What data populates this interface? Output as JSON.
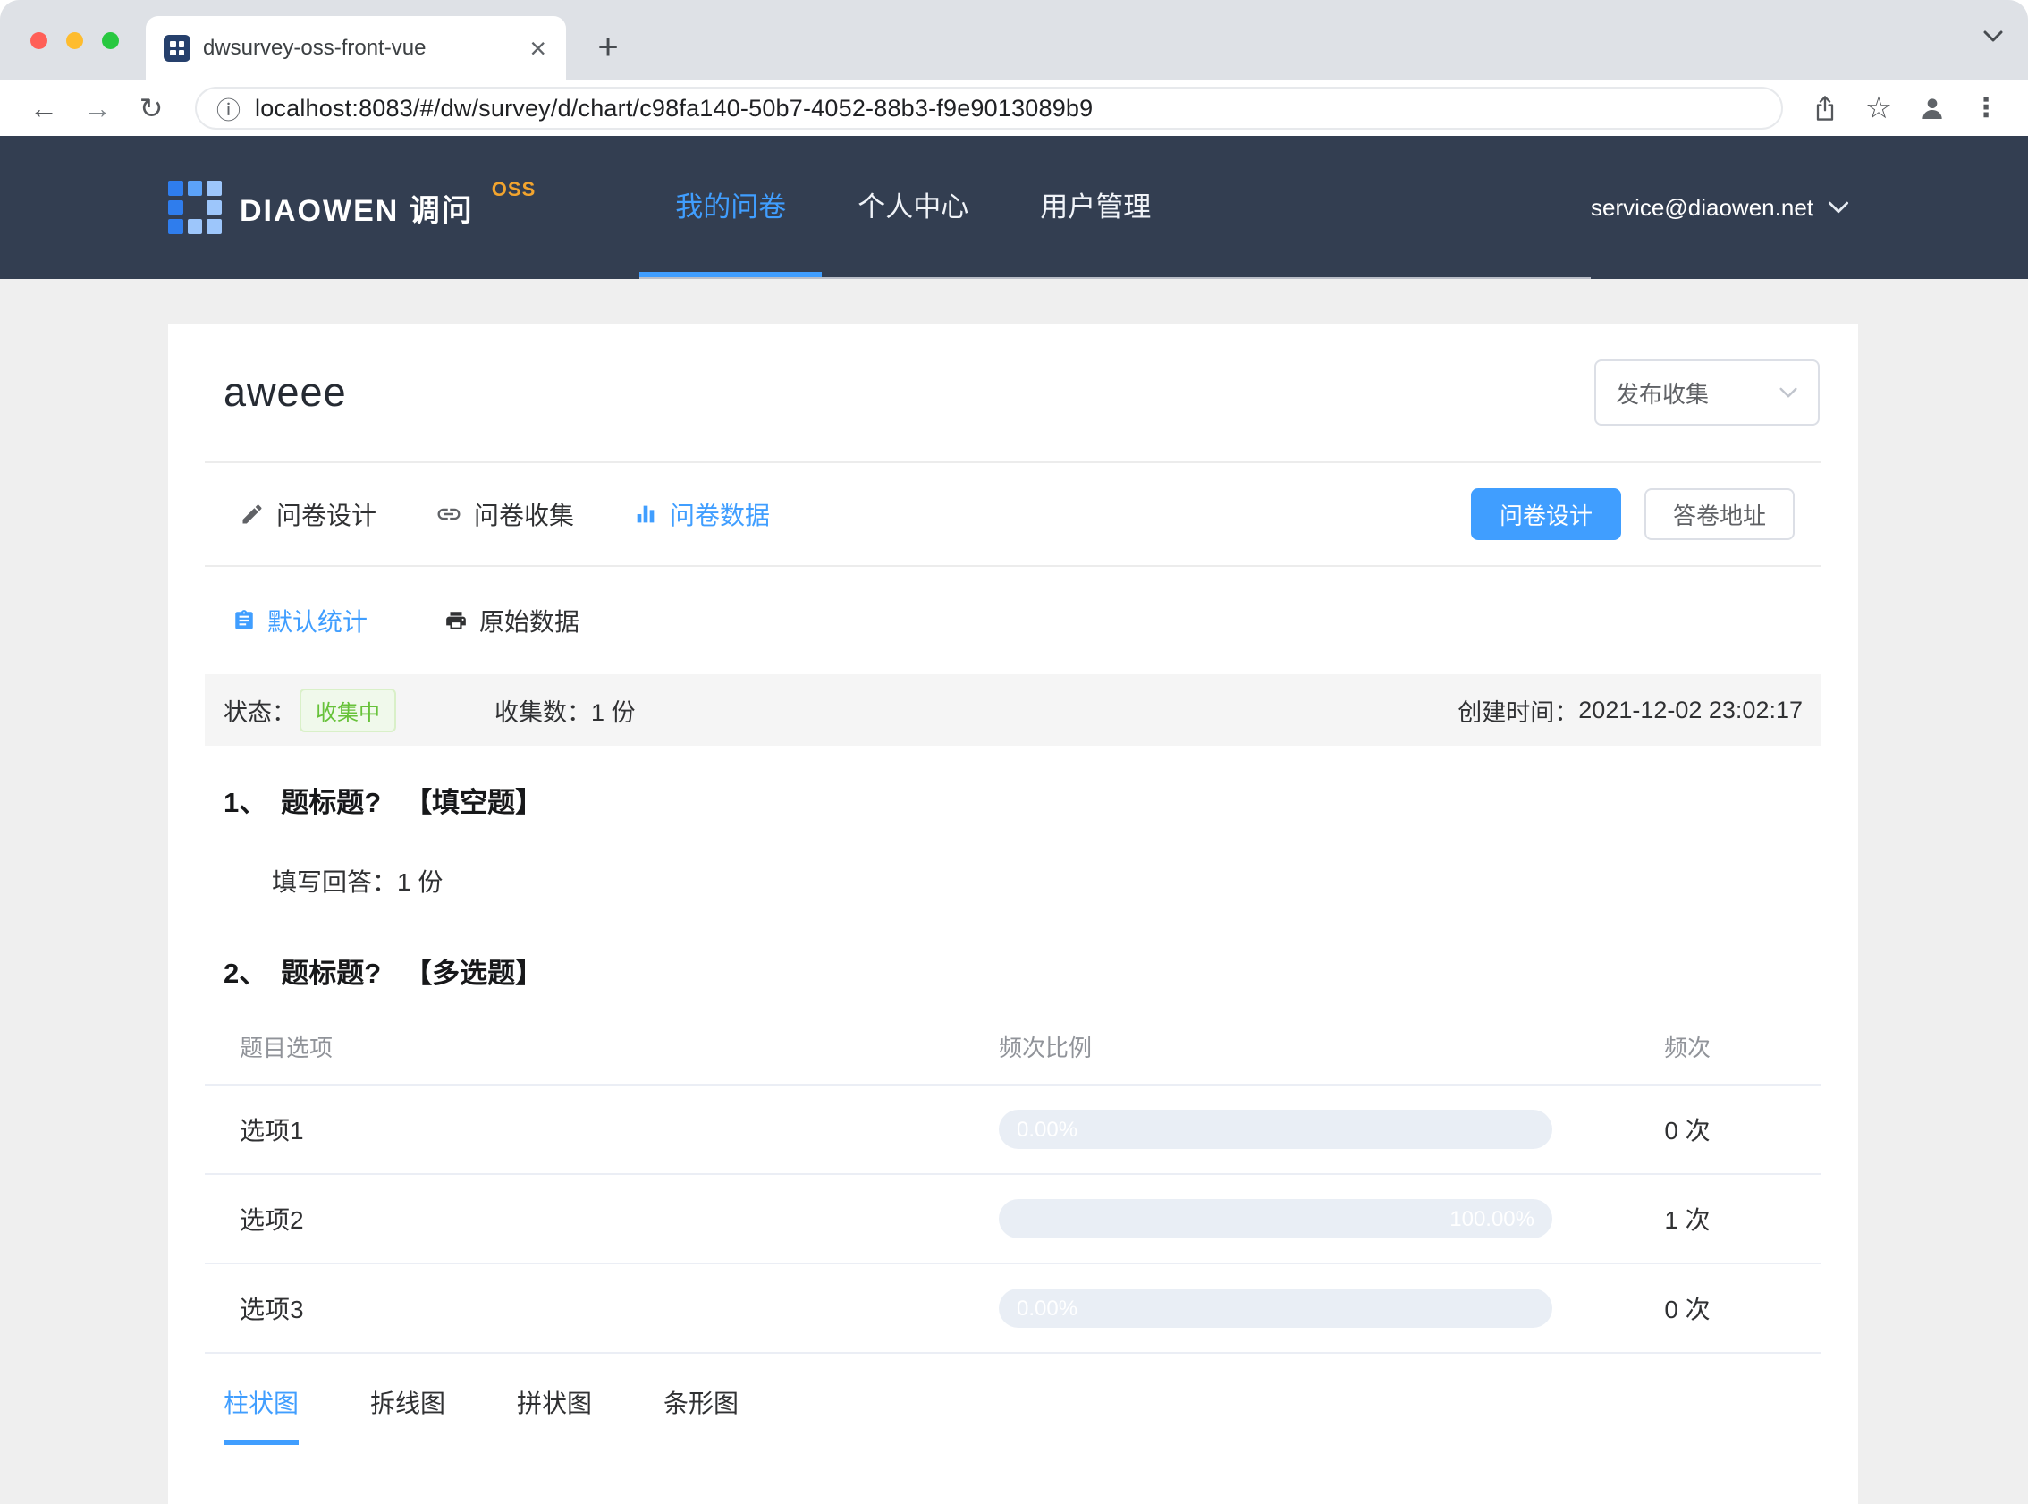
{
  "colors": {
    "accent_blue": "#409eff",
    "bar_fill_blue": "#5a9cf8",
    "header_bg": "#333e51",
    "success_green": "#67c23a",
    "success_bg": "#f0f9eb",
    "oss_orange": "#f2a42e",
    "page_bg": "#efefef"
  },
  "icons": {
    "back": "←",
    "forward": "→",
    "reload": "↻",
    "info": "ⓘ",
    "star": "☆",
    "menu_dots": "⋮",
    "plus": "+",
    "close": "×"
  },
  "browser": {
    "tab_title": "dwsurvey-oss-front-vue",
    "url": "localhost:8083/#/dw/survey/d/chart/c98fa140-50b7-4052-88b3-f9e9013089b9"
  },
  "header": {
    "brand": "DIAOWEN 调问",
    "brand_badge": "OSS",
    "nav": [
      {
        "label": "我的问卷",
        "active": true
      },
      {
        "label": "个人中心",
        "active": false
      },
      {
        "label": "用户管理",
        "active": false
      }
    ],
    "account": "service@diaowen.net"
  },
  "survey": {
    "title": "aweee",
    "publish_select": "发布收集",
    "tabs": [
      {
        "label": "问卷设计",
        "active": false
      },
      {
        "label": "问卷收集",
        "active": false
      },
      {
        "label": "问卷数据",
        "active": true
      }
    ],
    "actions": {
      "design": "问卷设计",
      "answer_address": "答卷地址"
    },
    "subtabs": [
      {
        "label": "默认统计",
        "active": true
      },
      {
        "label": "原始数据",
        "active": false
      }
    ],
    "status": {
      "label": "状态：",
      "badge": "收集中",
      "count_label": "收集数：",
      "count": "1 份",
      "created_label": "创建时间：",
      "created": "2021-12-02 23:02:17"
    },
    "questions": [
      {
        "index": "1、",
        "title": "题标题?",
        "type": "【填空题】",
        "answer_label": "填写回答：",
        "answer_count": "1 份"
      },
      {
        "index": "2、",
        "title": "题标题?",
        "type": "【多选题】"
      }
    ],
    "table": {
      "headers": [
        "题目选项",
        "频次比例",
        "频次"
      ],
      "rows": [
        {
          "option": "选项1",
          "percent": "0.00%",
          "value": 0,
          "count": "0 次"
        },
        {
          "option": "选项2",
          "percent": "100.00%",
          "value": 100,
          "count": "1 次"
        },
        {
          "option": "选项3",
          "percent": "0.00%",
          "value": 0,
          "count": "0 次"
        }
      ]
    },
    "chart_tabs": [
      {
        "label": "柱状图",
        "active": true
      },
      {
        "label": "拆线图",
        "active": false
      },
      {
        "label": "拼状图",
        "active": false
      },
      {
        "label": "条形图",
        "active": false
      }
    ]
  }
}
